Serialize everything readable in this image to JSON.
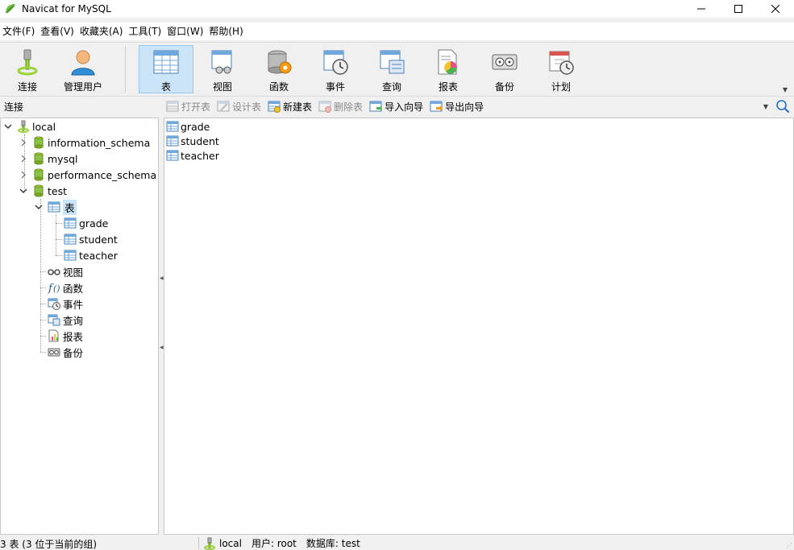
{
  "window": {
    "title": "Navicat for MySQL",
    "controls": {
      "minimize": "minimize-icon",
      "maximize": "maximize-icon",
      "close": "close-icon"
    }
  },
  "menu": [
    {
      "label": "文件(F)"
    },
    {
      "label": "查看(V)"
    },
    {
      "label": "收藏夹(A)"
    },
    {
      "label": "工具(T)"
    },
    {
      "label": "窗口(W)"
    },
    {
      "label": "帮助(H)"
    }
  ],
  "toolbar": {
    "items": [
      {
        "label": "连接",
        "icon": "connection-icon",
        "active": false
      },
      {
        "label": "管理用户",
        "icon": "user-icon",
        "active": false
      },
      {
        "label": "表",
        "icon": "table-icon",
        "active": true
      },
      {
        "label": "视图",
        "icon": "view-icon",
        "active": false
      },
      {
        "label": "函数",
        "icon": "function-icon",
        "active": false
      },
      {
        "label": "事件",
        "icon": "event-icon",
        "active": false
      },
      {
        "label": "查询",
        "icon": "query-icon",
        "active": false
      },
      {
        "label": "报表",
        "icon": "report-icon",
        "active": false
      },
      {
        "label": "备份",
        "icon": "backup-icon",
        "active": false
      },
      {
        "label": "计划",
        "icon": "schedule-icon",
        "active": false
      }
    ]
  },
  "subbar": {
    "connection_label": "连接",
    "actions": [
      {
        "label": "打开表",
        "enabled": false,
        "icon": "open-table-icon"
      },
      {
        "label": "设计表",
        "enabled": false,
        "icon": "design-table-icon"
      },
      {
        "label": "新建表",
        "enabled": true,
        "icon": "new-table-icon"
      },
      {
        "label": "删除表",
        "enabled": false,
        "icon": "delete-table-icon"
      },
      {
        "label": "导入向导",
        "enabled": true,
        "icon": "import-wizard-icon"
      },
      {
        "label": "导出向导",
        "enabled": true,
        "icon": "export-wizard-icon"
      }
    ]
  },
  "tree": {
    "connection": "local",
    "databases": [
      "information_schema",
      "mysql",
      "performance_schema",
      "test"
    ],
    "test_children": {
      "tables_label": "表",
      "tables": [
        "grade",
        "student",
        "teacher"
      ],
      "others": [
        "视图",
        "函数",
        "事件",
        "查询",
        "报表",
        "备份"
      ]
    }
  },
  "content": {
    "tables": [
      "grade",
      "student",
      "teacher"
    ]
  },
  "status": {
    "summary": "3 表 (3 位于当前的组)",
    "connection": "local",
    "user": "用户: root",
    "database": "数据库: test"
  },
  "colors": {
    "accent_selected": "#cce4f7",
    "accent_border": "#99c9ef",
    "db_icon": "#8bc34a"
  }
}
